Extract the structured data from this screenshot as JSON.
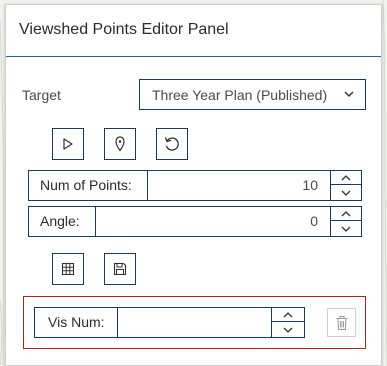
{
  "panel": {
    "title": "Viewshed Points Editor Panel"
  },
  "target": {
    "label": "Target",
    "selected": "Three Year Plan (Published)"
  },
  "tools": {
    "select_icon": "pointer-icon",
    "place_icon": "map-pin-icon",
    "reset_icon": "refresh-icon"
  },
  "num_points": {
    "label": "Num of Points:",
    "value": "10"
  },
  "angle": {
    "label": "Angle:",
    "value": "0"
  },
  "actions": {
    "table_icon": "table-icon",
    "save_icon": "save-icon"
  },
  "vis_num": {
    "label": "Vis Num:",
    "value": "",
    "delete_icon": "trash-icon"
  },
  "colors": {
    "accent": "#0b6aa2",
    "border": "#1d3a54",
    "highlight_border": "#b22222",
    "map_lines": "#d8dccf"
  }
}
